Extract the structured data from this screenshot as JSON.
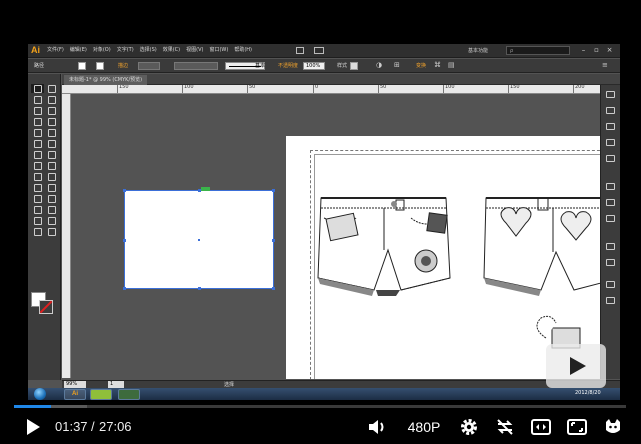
{
  "illustrator": {
    "logo": "Ai",
    "menu": [
      "文件(F)",
      "编辑(E)",
      "对象(O)",
      "文字(T)",
      "选择(S)",
      "效果(C)",
      "视图(V)",
      "窗口(W)",
      "帮助(H)"
    ],
    "workspace": "基本功能",
    "search_placeholder": "ρ",
    "control_bar": {
      "selection_label": "路径",
      "stroke_weight_label": "描边",
      "brush_preset": "基本",
      "opacity_label": "不透明度",
      "opacity_value": "100%",
      "style_label": "样式",
      "transform_label": "变换"
    },
    "document_tab": "未标题-1* @ 99% (CMYK/预览)",
    "ruler_numbers": [
      "150",
      "100",
      "50",
      "0",
      "50",
      "100",
      "150",
      "200"
    ],
    "status": {
      "zoom": "99%",
      "page": "1",
      "tool_text": "选择"
    },
    "taskbar": {
      "tray_date": "2012/8/20"
    }
  },
  "player": {
    "current_time": "01:37",
    "separator": "/",
    "duration": "27:06",
    "quality": "480P",
    "progress": 0.0597,
    "buffered": 0.12
  },
  "colors": {
    "progress": "#1f87e8",
    "ai_orange": "#f3a21a"
  },
  "icons": {
    "play": "play-icon",
    "volume": "volume-icon",
    "settings": "gear-icon",
    "loop": "loop-icon",
    "widescreen": "widescreen-icon",
    "fullscreen": "fullscreen-icon",
    "logo": "cat-logo-icon"
  }
}
